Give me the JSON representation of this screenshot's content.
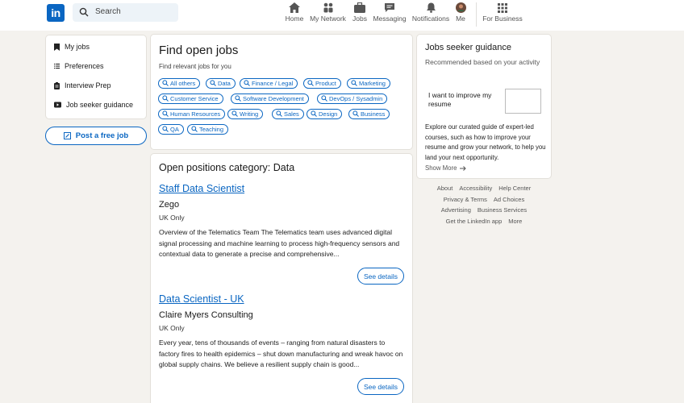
{
  "nav": {
    "logo": "in",
    "search_placeholder": "Search",
    "items": [
      {
        "label": "Home",
        "icon": "home-icon"
      },
      {
        "label": "My Network",
        "icon": "network-icon"
      },
      {
        "label": "Jobs",
        "icon": "briefcase-icon"
      },
      {
        "label": "Messaging",
        "icon": "messaging-icon"
      },
      {
        "label": "Notifications",
        "icon": "bell-icon"
      },
      {
        "label": "Me",
        "icon": "avatar"
      },
      {
        "label": "For Business",
        "icon": "grid-icon"
      }
    ]
  },
  "sidebar": {
    "items": [
      {
        "label": "My jobs",
        "icon": "bookmark-icon"
      },
      {
        "label": "Preferences",
        "icon": "list-icon"
      },
      {
        "label": "Interview Prep",
        "icon": "clipboard-icon"
      },
      {
        "label": "Job seeker guidance",
        "icon": "video-icon"
      }
    ],
    "post_job": "Post a free job"
  },
  "find_jobs": {
    "title": "Find open jobs",
    "subtitle": "Find relevant jobs for you",
    "chips": [
      "All others",
      "Data",
      "Finance / Legal",
      "Product",
      "Marketing",
      "Customer Service",
      "Software Development",
      "DevOps / Sysadmin",
      "Human Resources",
      "Writing",
      "Sales",
      "Design",
      "Business",
      "QA",
      "Teaching"
    ]
  },
  "positions": {
    "heading": "Open positions category: Data",
    "jobs": [
      {
        "title": "Staff Data Scientist",
        "company": "Zego",
        "location": "UK Only",
        "description": "Overview of the Telematics Team The Telematics team uses advanced digital signal processing and machine learning to process high-frequency sensors and contextual data to generate a precise and comprehensive...",
        "button": "See details"
      },
      {
        "title": "Data Scientist - UK",
        "company": "Claire Myers Consulting",
        "location": "UK Only",
        "description": "Every year, tens of thousands of events – ranging from natural disasters to factory fires to health epidemics – shut down manufacturing and wreak havoc on global supply chains. We believe a resilient supply chain is good...",
        "button": "See details"
      }
    ]
  },
  "guidance": {
    "title": "Jobs seeker guidance",
    "recommended": "Recommended based on your activity",
    "tip": "I want to improve my resume",
    "explore": "Explore our curated guide of expert-led courses, such as how to improve your resume and grow your network, to help you land your next opportunity.",
    "show_more": "Show More"
  },
  "footer": {
    "rows": [
      [
        "About",
        "Accessibility",
        "Help Center"
      ],
      [
        "Privacy & Terms",
        "Ad Choices"
      ],
      [
        "Advertising",
        "Business Services"
      ],
      [
        "Get the LinkedIn app",
        "More"
      ]
    ]
  },
  "colors": {
    "brand": "#0a66c2",
    "background": "#f4f2ee"
  }
}
